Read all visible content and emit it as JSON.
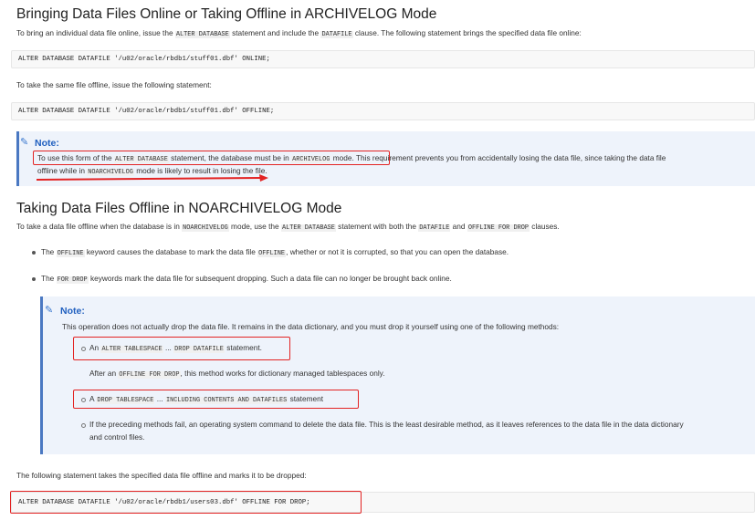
{
  "section1": {
    "title": "Bringing Data Files Online or Taking Offline in ARCHIVELOG Mode",
    "intro_a": "To bring an individual data file online, issue the ",
    "intro_code1": "ALTER DATABASE",
    "intro_b": " statement and include the ",
    "intro_code2": "DATAFILE",
    "intro_c": " clause. The following statement brings the specified data file online:",
    "code_online": "ALTER DATABASE DATAFILE '/u02/oracle/rbdb1/stuff01.dbf' ONLINE;",
    "offline_text": "To take the same file offline, issue the following statement:",
    "code_offline": "ALTER DATABASE DATAFILE '/u02/oracle/rbdb1/stuff01.dbf' OFFLINE;",
    "note": {
      "heading": "Note:",
      "l1_a": "To use this form of the ",
      "l1_code1": "ALTER DATABASE",
      "l1_b": " statement, the database must be in ",
      "l1_code2": "ARCHIVELOG",
      "l1_c": " mode.",
      "l1_d": " This requirement prevents you from accidentally losing the data file, since taking the data file",
      "l2_a": "offline while in ",
      "l2_code": "NOARCHIVELOG",
      "l2_b": " mode is likely to result in losing the file."
    }
  },
  "section2": {
    "title": "Taking Data Files Offline in NOARCHIVELOG Mode",
    "intro_a": "To take a data file offline when the database is in ",
    "intro_code1": "NOARCHIVELOG",
    "intro_b": " mode, use the ",
    "intro_code2": "ALTER DATABASE",
    "intro_c": " statement with both the ",
    "intro_code3": "DATAFILE",
    "intro_d": " and ",
    "intro_code4": "OFFLINE FOR DROP",
    "intro_e": " clauses.",
    "bullet1_a": "The ",
    "bullet1_code1": "OFFLINE",
    "bullet1_b": " keyword causes the database to mark the data file ",
    "bullet1_code2": "OFFLINE",
    "bullet1_c": ", whether or not it is corrupted, so that you can open the database.",
    "bullet2_a": "The ",
    "bullet2_code": "FOR DROP",
    "bullet2_b": " keywords mark the data file for subsequent dropping. Such a data file can no longer be brought back online.",
    "note": {
      "heading": "Note:",
      "intro": "This operation does not actually drop the data file. It remains in the data dictionary, and you must drop it yourself using one of the following methods:",
      "m1_a": "An ",
      "m1_code1": "ALTER TABLESPACE",
      "m1_b": " ... ",
      "m1_code2": "DROP DATAFILE",
      "m1_c": " statement.",
      "m1_sub_a": "After an ",
      "m1_sub_code": "OFFLINE FOR DROP",
      "m1_sub_b": ", this method works for dictionary managed tablespaces only.",
      "m2_a": "A ",
      "m2_code1": "DROP TABLESPACE",
      "m2_b": " ... ",
      "m2_code2": "INCLUDING CONTENTS AND DATAFILES",
      "m2_c": " statement",
      "m3_l1": "If the preceding methods fail, an operating system command to delete the data file. This is the least desirable method, as it leaves references to the data file in the data dictionary",
      "m3_l2": "and control files."
    },
    "final_text": "The following statement takes the specified data file offline and marks it to be dropped:",
    "code_drop": "ALTER DATABASE DATAFILE '/u02/oracle/rbdb1/users03.dbf' OFFLINE FOR DROP;"
  },
  "icons": {
    "note_icon": "pencil-icon"
  },
  "colors": {
    "annotation_red": "#e32323",
    "note_blue": "#1f5fbf",
    "note_bg": "#eef3fb"
  }
}
